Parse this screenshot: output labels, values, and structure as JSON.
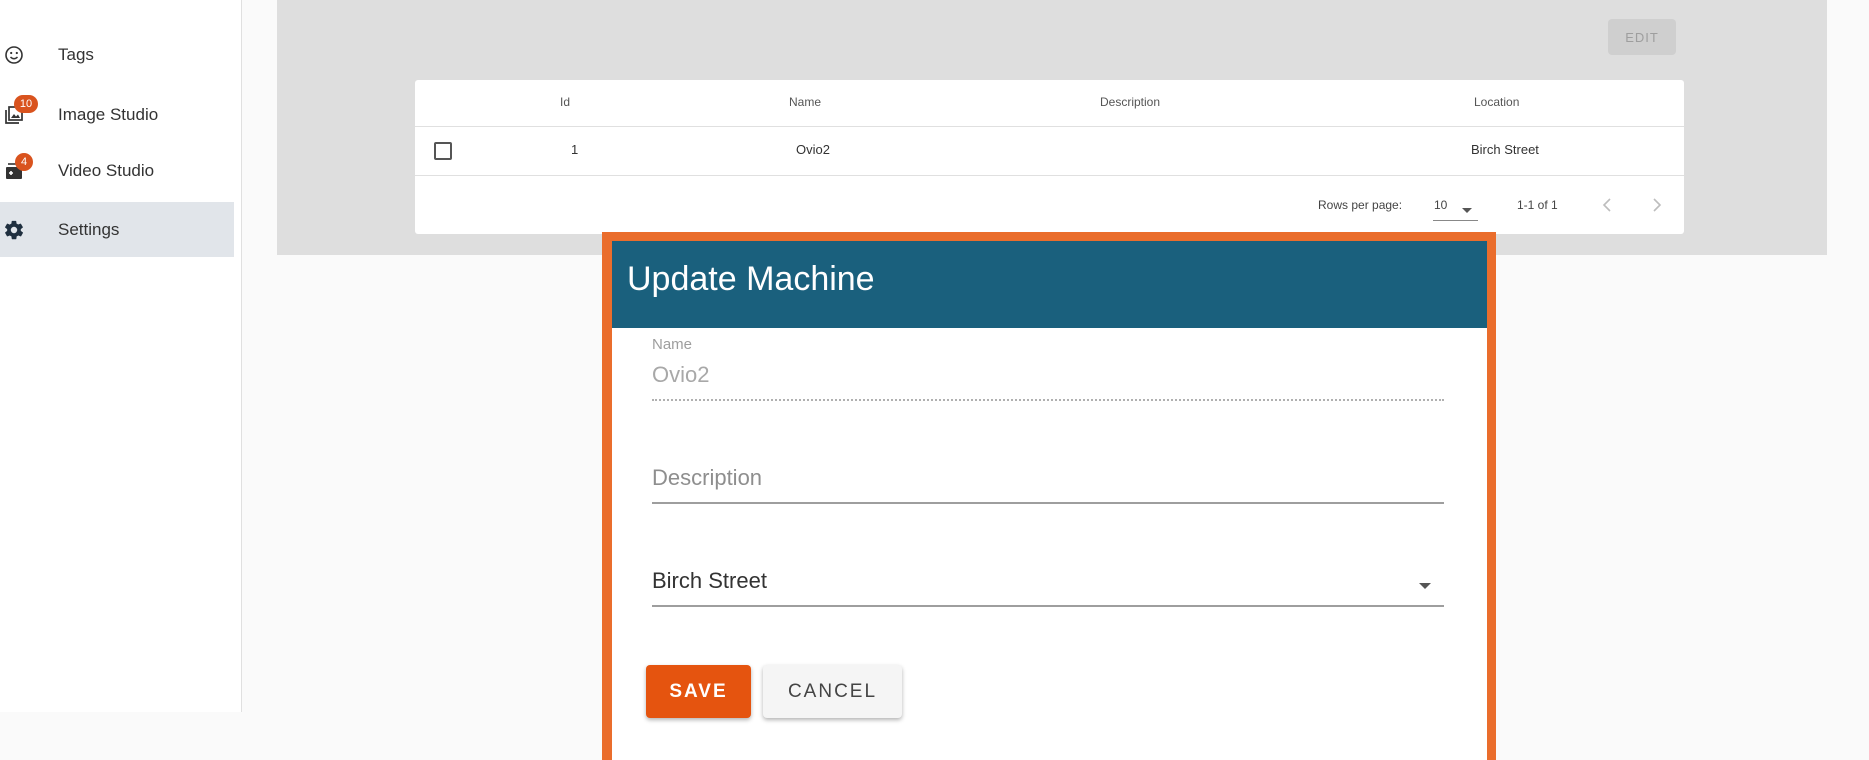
{
  "sidebar": {
    "items": [
      {
        "label": "Tags",
        "icon": "smiley-icon"
      },
      {
        "label": "Image Studio",
        "icon": "image-library-icon",
        "badge": "10"
      },
      {
        "label": "Video Studio",
        "icon": "video-add-icon",
        "badge": "4"
      },
      {
        "label": "Settings",
        "icon": "gear-icon",
        "active": true
      }
    ]
  },
  "toolbar": {
    "edit_label": "EDIT"
  },
  "table": {
    "columns": [
      "Id",
      "Name",
      "Description",
      "Location"
    ],
    "rows": [
      {
        "id": "1",
        "name": "Ovio2",
        "description": "",
        "location": "Birch Street"
      }
    ],
    "pagination": {
      "rows_per_page_label": "Rows per page:",
      "rows_per_page_value": "10",
      "range": "1-1 of 1"
    }
  },
  "modal": {
    "title": "Update Machine",
    "name_label": "Name",
    "name_value": "Ovio2",
    "description_placeholder": "Description",
    "location_value": "Birch Street",
    "save_label": "SAVE",
    "cancel_label": "CANCEL"
  },
  "colors": {
    "modal_header": "#1a607d",
    "modal_frame": "#ea6d2c",
    "save_button": "#e5540f",
    "badge": "#d9531e"
  }
}
